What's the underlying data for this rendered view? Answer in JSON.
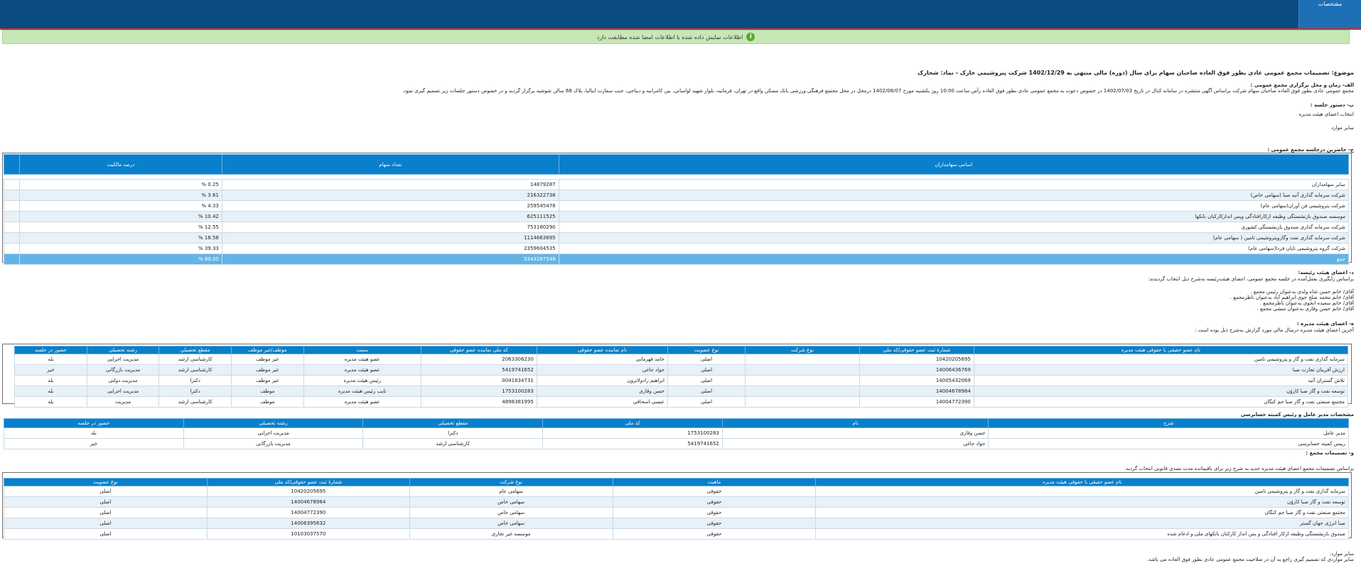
{
  "topbar": {
    "tab_label": "مشخصات"
  },
  "notice": {
    "icon": "info-icon",
    "text": "اطلاعات نمایش داده شده با اطلاعات امضا شده مطابقت دارد"
  },
  "subject": {
    "label": "موضوع:",
    "text": "تصمیمات مجمع عمومی عادی بطور فوق العاده صاحبان سهام برای سال (دوره) مالی منتهی به 1402/12/29 شرکت پتروشیمی خارک - نماد: شخارک"
  },
  "section_a": {
    "title": "الف- زمان و محل برگزاری مجمع عمومی :",
    "text": "مجمع عمومی عادی بطور فوق العاده صاحبان سهام شرکت براساس آگهی منتشره در سامانه کدال در تاریخ 1402/07/03 در خصوص دعوت به مجمع عمومی عادی بطور فوق العاده رأس ساعت 10:00 روز یکشنبه مورخ 1402/08/07 درمحل در محل مجتمع فرهنگی ورزشی بانک مسکن واقع در تهران، فرمانیه، بلوار شهید لواسانی، بین کامرانیه و دیباجی، جنب سفارت ایتالیا، پلاک 68 سالن شوشیه برگزار گردید و در خصوص دستور جلسات زیر تصمیم گیری نمود."
  },
  "section_b": {
    "title": "ب- دستور جلسه :",
    "items": [
      "انتخاب اعضای هیئت مدیره",
      "سایر موارد"
    ]
  },
  "section_c": {
    "title": "ج- حاضرین درجلسه مجمع عمومی :",
    "headers": [
      "اسامی سهامداران",
      "تعداد سهام",
      "درصد مالکیت"
    ],
    "rows": [
      [
        "سایر سهامداران",
        "14879287",
        "% 0.25"
      ],
      [
        "شرکت سرمایه گذاری آتیه صبا (سهامی خاص)",
        "216322738",
        "% 3.61"
      ],
      [
        "شرکت پتروشیمی فن آوران(سهامی عام)",
        "259545478",
        "% 4.33"
      ],
      [
        "موسسه صندوق بازنشستگی وظیفه ازکارافتادگی وپس اندازکارکنان بانکها",
        "625111525",
        "% 10.42"
      ],
      [
        "شرکت سرمایه گذاری صندوق بازنشستگی کشوری",
        "753160290",
        "% 12.55"
      ],
      [
        "شرکت سرمایه گذاری نفت وگازوپتروشیمی تامین ( سهامی عام)",
        "1114663695",
        "% 18.58"
      ],
      [
        "شرکت گروه پتروشیمی تاپان فردا(سهامی عام)",
        "2359604535",
        "% 39.33"
      ]
    ],
    "total": [
      "جمع",
      "5343287548",
      "% 89.05"
    ]
  },
  "section_d": {
    "title": "د- اعضای هیئت رئیسه:",
    "text": "براساس رأیگیری بعمل‌آمده در جلسه مجمع عمومی، اعضای هیئت‌رئیسه به‌شرح ذیل انتخاب گردیدند:",
    "items": [
      "آقای/ خانم حسن شاه ولدی به‌عنوان رئیس مجمع .",
      "آقای/ خانم محمد صلح جوی ابراهیم آباد به‌عنوان ناظرمجمع .",
      "آقای/ خانم سعیده انجوی به‌عنوان ناظرمجمع .",
      "آقای/ خانم حسن وقاری به‌عنوان منشی مجمع ."
    ]
  },
  "section_e": {
    "title": "ه- اعضای هیئت مدیره :",
    "text": "آخرین اعضای هیئت مدیره درسال مالی مورد گزارش به‌شرح ذیل بوده است :",
    "headers": [
      "نام عضو حقیقی یا حقوقی هیئت مدیره",
      "شمارۀ ثبت عضو حقوقی/کد ملی",
      "نوع شرکت",
      "نوع عضویت",
      "نام نماینده عضو حقوقی",
      "کد ملی نماینده عضو حقوقی",
      "سمت",
      "موظف/غیر موظف",
      "مقطع تحصیلی",
      "رشته تحصیلی",
      "حضور در جلسه"
    ],
    "rows": [
      [
        "سرمایه گذاری نفت و گاز و پتروشیمی تامین",
        "10420205695",
        "",
        "اصلی",
        "حامد قهرمانی",
        "2063306230",
        "عضو هیئت مدیره",
        "غیر موظف",
        "کارشناسی ارشد",
        "مدیریت اجرایی",
        "بله"
      ],
      [
        "ارزش آفرینان تجارت صبا",
        "14006436769",
        "",
        "اصلی",
        "جواد جاغی",
        "5419741652",
        "عضو هیئت مدیره",
        "غیر موظف",
        "کارشناسی ارشد",
        "مدیریت بازرگانی",
        "خیر"
      ],
      [
        "تلاش گستران آتیه",
        "14005432069",
        "",
        "اصلی",
        "ابراهیم رادولاترون",
        "0041634731",
        "رئیس هیئت مدیره",
        "غیر موظف",
        "دکترا",
        "مدیریت دولتی",
        "بله"
      ],
      [
        "توسعه نفت و گاز صبا کاروُن",
        "14004678984",
        "",
        "اصلی",
        "حسن وقاری",
        "1753100283",
        "نایب رئیس هیئت مدیره",
        "موظف",
        "دکترا",
        "مدیریت اجرایی",
        "بله"
      ],
      [
        "مجتمع صنعتی نفت و گاز صبا جم کنگان",
        "14004772390",
        "",
        "اصلی",
        "عیسی اسحاقی",
        "4898381995",
        "عضو هیئت مدیره",
        "موظف",
        "کارشناسی ارشد",
        "مدیریت",
        "بله"
      ]
    ]
  },
  "ceo_section": {
    "title": "مشخصات مدیر عامل و رئیس کمیته حسابرسی",
    "headers": [
      "شرح",
      "نام",
      "کد ملی",
      "مقطع تحصیلی",
      "رشته تحصیلی",
      "حضور در جلسه"
    ],
    "rows": [
      [
        "مدیر عامل",
        "حسن وقاری",
        "1753100283",
        "دکترا",
        "مدیریت اجرایی",
        "بله"
      ],
      [
        "رییس کمیته حسابرسی",
        "جواد جاغی",
        "5419741652",
        "کارشناسی ارشد",
        "مدیریت بازرگانی",
        "خیر"
      ]
    ]
  },
  "section_f": {
    "title": "و- تصمیمات مجمع :",
    "text": "براساس تصمیمات مجمع اعضای هیئت مدیره جدید به شرح زیر برای باقیمانده مدت تصدی قانونی انتخاب گردید.",
    "headers": [
      "نام عضو حقیقی یا حقوقی هیئت مدیره",
      "ماهیت",
      "نوع شرکت",
      "شمارۀ ثبت عضو حقوقی/کد ملی",
      "نوع عضویت"
    ],
    "rows": [
      [
        "سرمایه گذاری نفت و گاز و پتروشیمی تامین",
        "حقوقی",
        "سهامی عام",
        "10420205695",
        "اصلی"
      ],
      [
        "توسعه نفت و گاز صبا کاروُن",
        "حقوقی",
        "سهامی خاص",
        "14004678984",
        "اصلی"
      ],
      [
        "مجتمع صنعتی نفت و گاز صبا جم کنگان",
        "حقوقی",
        "سهامی خاص",
        "14004772390",
        "اصلی"
      ],
      [
        "صبا انرژی جهان گستر",
        "حقوقی",
        "سهامی خاص",
        "14006395832",
        "اصلی"
      ],
      [
        "صندوق بازنشستگی وظیفه ازکار افتادگی و پس انداز کارکنان بانکهای ملی و ادغام شده",
        "حقوقی",
        "موسسه غیر تجاری",
        "10103037570",
        "اصلی"
      ]
    ]
  },
  "other": {
    "title": "سایر موارد:",
    "text": "سایر مواردی که تصمیم گیری راجع به آن در صلاحیت مجمع عمومی عادی بطور فوق العاده می باشد."
  }
}
